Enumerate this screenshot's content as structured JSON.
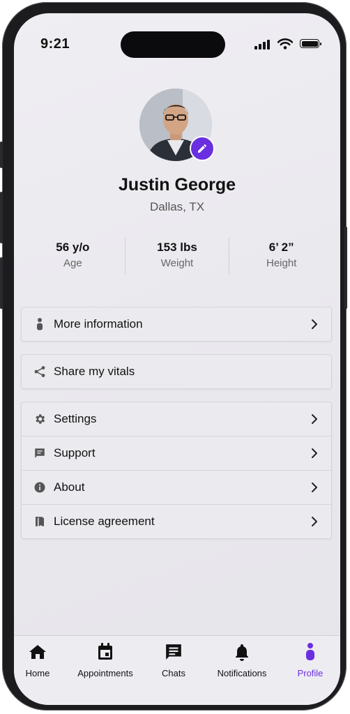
{
  "status_bar": {
    "time": "9:21"
  },
  "profile": {
    "name": "Justin George",
    "location": "Dallas, TX"
  },
  "stats": [
    {
      "value": "56 y/o",
      "label": "Age"
    },
    {
      "value": "153 lbs",
      "label": "Weight"
    },
    {
      "value": "6’ 2”",
      "label": "Height"
    }
  ],
  "menu": {
    "more_info": "More information",
    "share_vitals": "Share my vitals",
    "settings": "Settings",
    "support": "Support",
    "about": "About",
    "license": "License agreement"
  },
  "tabs": [
    {
      "label": "Home",
      "icon": "home-icon"
    },
    {
      "label": "Appointments",
      "icon": "calendar-icon"
    },
    {
      "label": "Chats",
      "icon": "chat-icon"
    },
    {
      "label": "Notifications",
      "icon": "bell-icon"
    },
    {
      "label": "Profile",
      "icon": "person-icon",
      "active": true
    }
  ],
  "colors": {
    "accent": "#6a2fe0",
    "background": "#eceaef",
    "card": "#ebeaee"
  }
}
